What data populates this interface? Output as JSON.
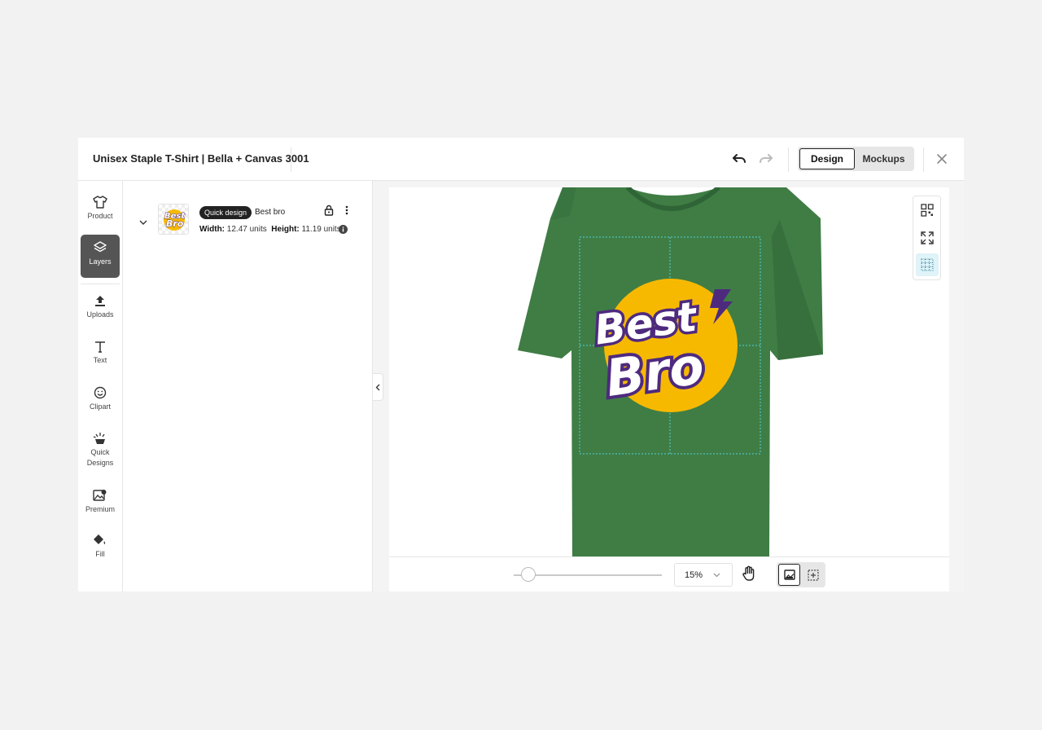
{
  "header": {
    "title": "Unisex Staple T-Shirt | Bella + Canvas 3001",
    "tabs": [
      {
        "label": "Design",
        "active": true
      },
      {
        "label": "Mockups",
        "active": false
      }
    ]
  },
  "sidebar": {
    "items": [
      {
        "label": "Product",
        "icon": "tshirt-icon"
      },
      {
        "label": "Layers",
        "icon": "layers-icon",
        "active": true
      },
      {
        "label": "Uploads",
        "icon": "upload-icon"
      },
      {
        "label": "Text",
        "icon": "text-icon"
      },
      {
        "label": "Clipart",
        "icon": "smiley-icon"
      },
      {
        "label": "Quick Designs",
        "icon": "sparkle-icon"
      },
      {
        "label": "Premium",
        "icon": "premium-image-icon"
      },
      {
        "label": "Fill",
        "icon": "paint-bucket-icon"
      }
    ]
  },
  "layer": {
    "badge": "Quick design",
    "name": "Best bro",
    "width_label": "Width:",
    "width_value": "12.47 units",
    "height_label": "Height:",
    "height_value": "11.19 units"
  },
  "design": {
    "line1": "Best",
    "line2": "Bro",
    "shirt_color": "#3f7d45",
    "circle_color": "#f7b900",
    "outline_color": "#4e2a7f"
  },
  "zoom": {
    "value": "15%",
    "slider_fraction": 0.1
  }
}
